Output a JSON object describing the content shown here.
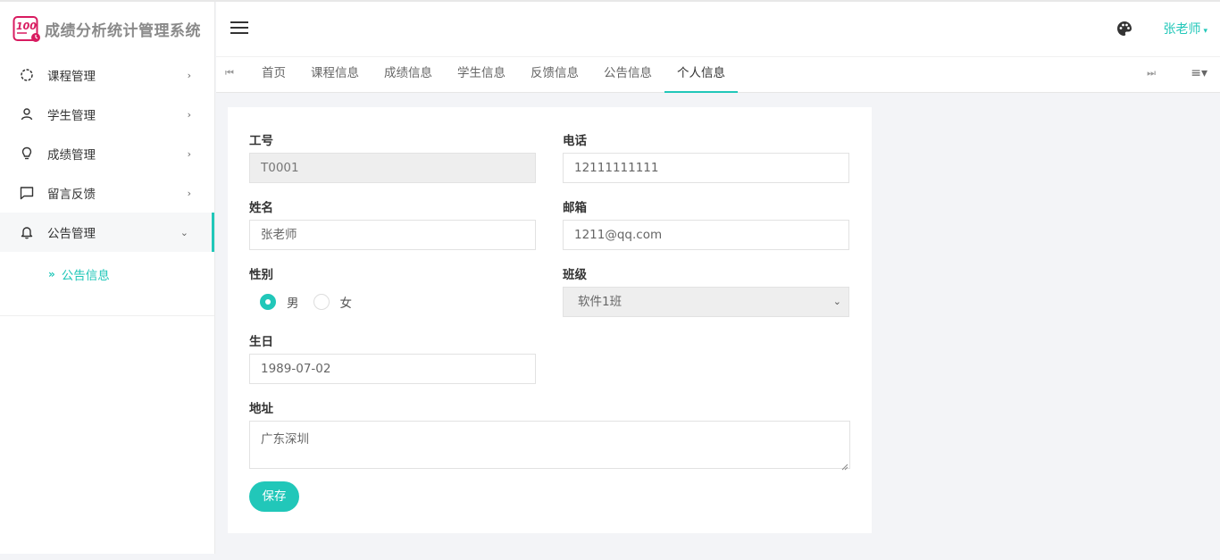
{
  "app": {
    "title": "成绩分析统计管理系统",
    "logo_icon": "score-100-logo-icon",
    "accent_color": "#21c7b9"
  },
  "sidebar": {
    "items": [
      {
        "label": "课程管理",
        "icon": "circle-icon",
        "arrow": "›"
      },
      {
        "label": "学生管理",
        "icon": "user-icon",
        "arrow": "›"
      },
      {
        "label": "成绩管理",
        "icon": "lightbulb-icon",
        "arrow": "›"
      },
      {
        "label": "留言反馈",
        "icon": "message-icon",
        "arrow": "›"
      },
      {
        "label": "公告管理",
        "icon": "bell-icon",
        "arrow": "⌄",
        "expanded": true
      }
    ],
    "submenu": {
      "chevron": "»",
      "label": "公告信息"
    }
  },
  "header": {
    "user_name": "张老师",
    "user_caret": "▾"
  },
  "tabs": {
    "prev_glyph": "⏮",
    "next_glyph": "⏭",
    "menu_glyph": "≡▾",
    "items": [
      "首页",
      "课程信息",
      "成绩信息",
      "学生信息",
      "反馈信息",
      "公告信息",
      "个人信息"
    ],
    "active": "个人信息"
  },
  "form": {
    "id": {
      "label": "工号",
      "value": "T0001"
    },
    "phone": {
      "label": "电话",
      "value": "12111111111"
    },
    "name": {
      "label": "姓名",
      "value": "张老师"
    },
    "email": {
      "label": "邮箱",
      "value": "1211@qq.com"
    },
    "gender": {
      "label": "性别",
      "options": [
        "男",
        "女"
      ],
      "selected": "男"
    },
    "class": {
      "label": "班级",
      "value": "软件1班"
    },
    "birthday": {
      "label": "生日",
      "value": "1989-07-02"
    },
    "address": {
      "label": "地址",
      "value": "广东深圳"
    },
    "save_label": "保存"
  }
}
